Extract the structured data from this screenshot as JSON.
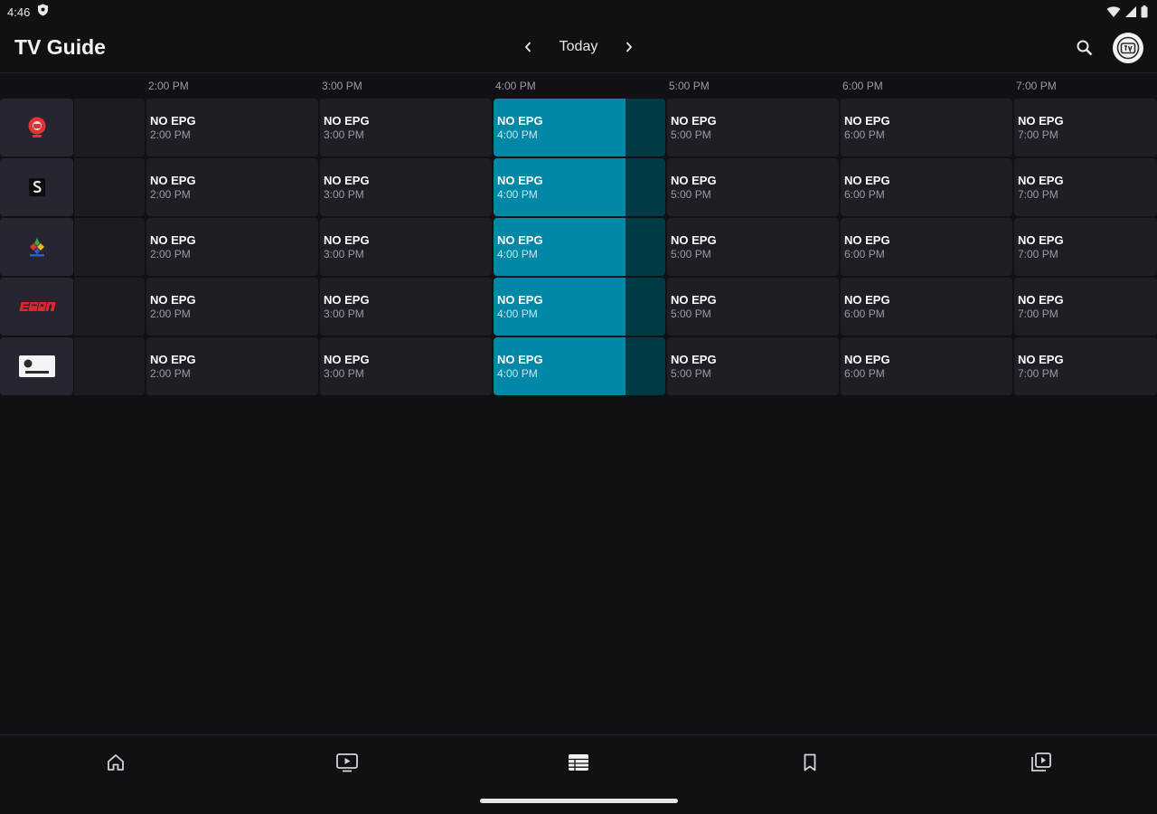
{
  "status_bar": {
    "time": "4:46"
  },
  "app_bar": {
    "title": "TV Guide",
    "date_label": "Today"
  },
  "timeline": {
    "ticks": [
      "2:00 PM",
      "3:00 PM",
      "4:00 PM",
      "5:00 PM",
      "6:00 PM",
      "7:00 PM"
    ]
  },
  "guide": {
    "rows": [
      {
        "channel": "channel-1",
        "programs": [
          {
            "title": "NO EPG",
            "time": "2:00 PM"
          },
          {
            "title": "NO EPG",
            "time": "3:00 PM"
          },
          {
            "title": "NO EPG",
            "time": "4:00 PM"
          },
          {
            "title": "NO EPG",
            "time": "5:00 PM"
          },
          {
            "title": "NO EPG",
            "time": "6:00 PM"
          },
          {
            "title": "NO EPG",
            "time": "7:00 PM"
          }
        ]
      },
      {
        "channel": "channel-2",
        "programs": [
          {
            "title": "NO EPG",
            "time": "2:00 PM"
          },
          {
            "title": "NO EPG",
            "time": "3:00 PM"
          },
          {
            "title": "NO EPG",
            "time": "4:00 PM"
          },
          {
            "title": "NO EPG",
            "time": "5:00 PM"
          },
          {
            "title": "NO EPG",
            "time": "6:00 PM"
          },
          {
            "title": "NO EPG",
            "time": "7:00 PM"
          }
        ]
      },
      {
        "channel": "channel-3",
        "programs": [
          {
            "title": "NO EPG",
            "time": "2:00 PM"
          },
          {
            "title": "NO EPG",
            "time": "3:00 PM"
          },
          {
            "title": "NO EPG",
            "time": "4:00 PM"
          },
          {
            "title": "NO EPG",
            "time": "5:00 PM"
          },
          {
            "title": "NO EPG",
            "time": "6:00 PM"
          },
          {
            "title": "NO EPG",
            "time": "7:00 PM"
          }
        ]
      },
      {
        "channel": "espn",
        "programs": [
          {
            "title": "NO EPG",
            "time": "2:00 PM"
          },
          {
            "title": "NO EPG",
            "time": "3:00 PM"
          },
          {
            "title": "NO EPG",
            "time": "4:00 PM"
          },
          {
            "title": "NO EPG",
            "time": "5:00 PM"
          },
          {
            "title": "NO EPG",
            "time": "6:00 PM"
          },
          {
            "title": "NO EPG",
            "time": "7:00 PM"
          }
        ]
      },
      {
        "channel": "channel-5",
        "programs": [
          {
            "title": "NO EPG",
            "time": "2:00 PM"
          },
          {
            "title": "NO EPG",
            "time": "3:00 PM"
          },
          {
            "title": "NO EPG",
            "time": "4:00 PM"
          },
          {
            "title": "NO EPG",
            "time": "5:00 PM"
          },
          {
            "title": "NO EPG",
            "time": "6:00 PM"
          },
          {
            "title": "NO EPG",
            "time": "7:00 PM"
          }
        ]
      }
    ],
    "current_slot": 2,
    "current_progress": 0.77
  },
  "bottom_nav": {
    "items": [
      "home-icon",
      "live-tv-icon",
      "guide-icon",
      "bookmark-icon",
      "library-icon"
    ],
    "selected": 2
  },
  "colors": {
    "background": "#111015",
    "accent": "#0088a6",
    "accent_dark": "#003a44",
    "cell": "#1f1e25",
    "espn_red": "#e0262b"
  }
}
